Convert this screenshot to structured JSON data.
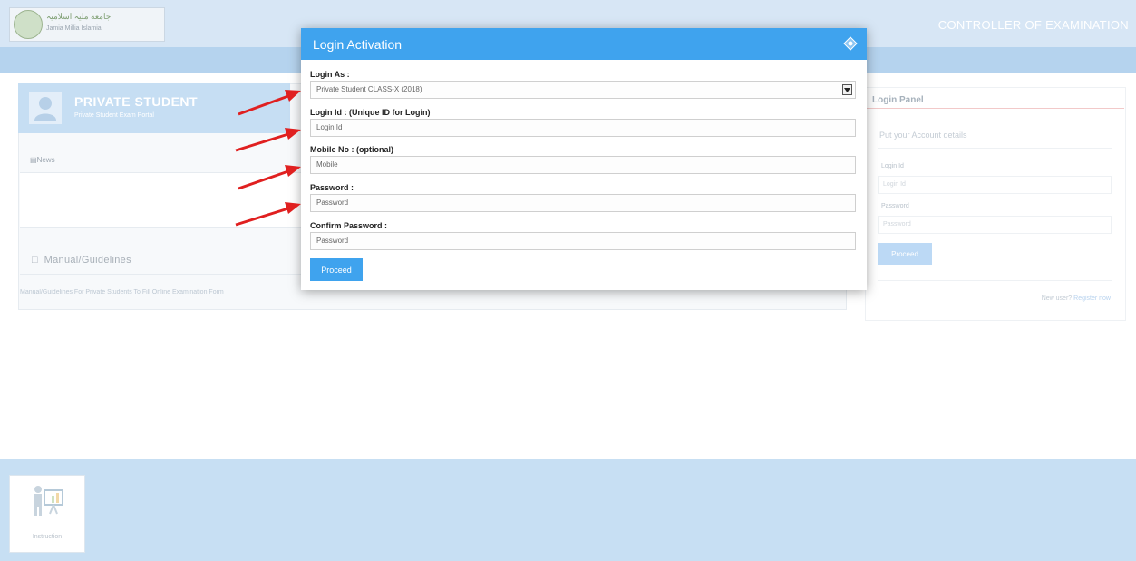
{
  "header": {
    "logo_line1": "جامعة ملیہ اسلامیہ",
    "logo_line2": "Jamia Millia Islamia",
    "title": "CONTROLLER OF EXAMINATION"
  },
  "student_card": {
    "title": "PRIVATE STUDENT",
    "subtitle": "Private Student Exam Portal"
  },
  "news": {
    "label": "News"
  },
  "manual": {
    "title": "Manual/Guidelines",
    "link": "Manual/Guidelines For Private Students To Fill Online Examination Form"
  },
  "login_panel": {
    "title": "Login Panel",
    "description": "Put your Account details",
    "login_id_label": "Login Id",
    "login_id_placeholder": "Login Id",
    "password_label": "Password",
    "password_placeholder": "Password",
    "proceed": "Proceed",
    "register_prefix": "New user?",
    "register_link": "Register now"
  },
  "footer_tile": {
    "label": "Instruction"
  },
  "modal": {
    "title": "Login Activation",
    "login_as_label": "Login As :",
    "login_as_value": "Private Student CLASS-X (2018)",
    "login_id_label": "Login Id : (Unique ID for Login)",
    "login_id_placeholder": "Login Id",
    "mobile_label": "Mobile No : (optional)",
    "mobile_placeholder": "Mobile",
    "password_label": "Password :",
    "password_placeholder": "Password",
    "confirm_label": "Confirm Password :",
    "confirm_placeholder": "Password",
    "proceed": "Proceed"
  },
  "colors": {
    "modal_header": "#3fa3ee",
    "arrow": "#e02020",
    "nav_band": "#b5d3ee"
  }
}
